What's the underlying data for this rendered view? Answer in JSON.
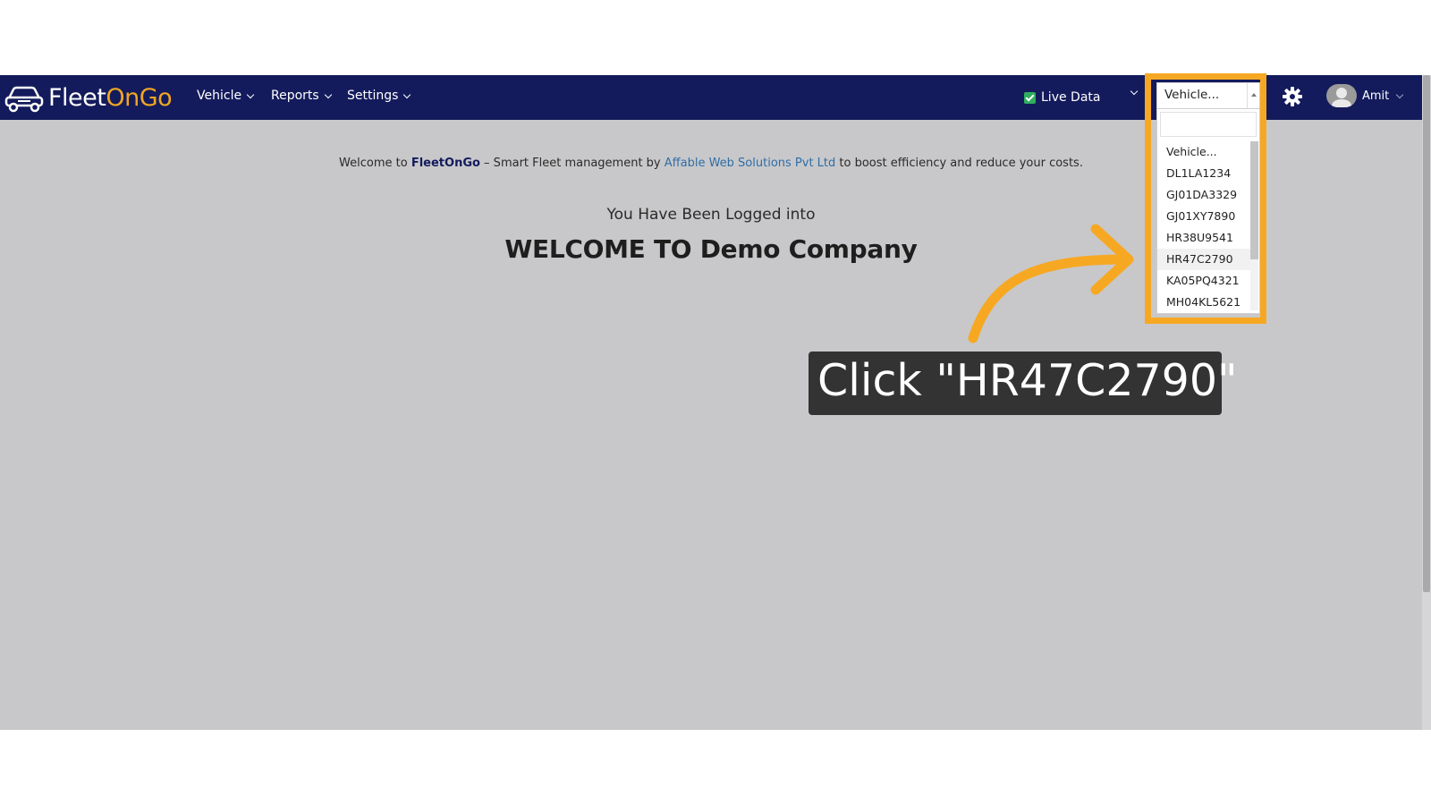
{
  "brand": {
    "name_part1": "Fleet",
    "name_part2": "OnGo",
    "accent_color": "#f0a623",
    "nav_color": "#141b5c"
  },
  "nav": {
    "items": [
      {
        "label": "Vehicle"
      },
      {
        "label": "Reports"
      },
      {
        "label": "Settings"
      }
    ],
    "live_data_label": "Live Data",
    "live_data_checked": true,
    "vehicle_select_value": "Vehicle...",
    "user_name": "Amit"
  },
  "main": {
    "welcome_prefix": "Welcome to ",
    "welcome_brand": "FleetOnGo",
    "welcome_middle": " – Smart Fleet management by ",
    "welcome_company": "Affable Web Solutions Pvt Ltd",
    "welcome_suffix": " to boost efficiency and reduce your costs.",
    "logged_in_text": "You Have Been Logged into",
    "welcome_title": "WELCOME TO Demo Company"
  },
  "dropdown": {
    "search_value": "",
    "options": [
      "Vehicle...",
      "DL1LA1234",
      "GJ01DA3329",
      "GJ01XY7890",
      "HR38U9541",
      "HR47C2790",
      "KA05PQ4321",
      "MH04KL5621"
    ],
    "hovered_option": "HR47C2790"
  },
  "tutorial": {
    "callout_text": "Click \"HR47C2790\"",
    "highlight_color": "#f7a823"
  }
}
